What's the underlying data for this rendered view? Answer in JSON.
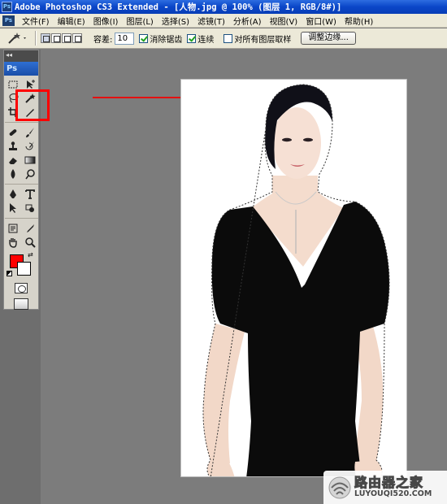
{
  "window": {
    "title": "Adobe Photoshop CS3 Extended - [人物.jpg @ 100% (图层 1, RGB/8#)]"
  },
  "menu": {
    "items": [
      "文件(F)",
      "编辑(E)",
      "图像(I)",
      "图层(L)",
      "选择(S)",
      "滤镜(T)",
      "分析(A)",
      "视图(V)",
      "窗口(W)",
      "帮助(H)"
    ]
  },
  "options": {
    "tool_icon": "magic-wand-icon",
    "tolerance_label": "容差:",
    "tolerance_value": "10",
    "antialias_label": "消除锯齿",
    "antialias_checked": true,
    "contiguous_label": "连续",
    "contiguous_checked": true,
    "sample_all_label": "对所有图层取样",
    "sample_all_checked": false,
    "refine_edge_label": "调整边缘..."
  },
  "tools": {
    "panel_header": "◂◂",
    "logo": "Ps",
    "selected_tool": "magic-wand-tool",
    "foreground_color": "#ff0000",
    "background_color": "#ffffff"
  },
  "annotation": {
    "highlight_color": "#ff0000",
    "arrow_color": "#ff0000"
  },
  "canvas": {
    "document_name": "人物.jpg",
    "zoom": "100%"
  },
  "watermark": {
    "title": "路由器之家",
    "url": "LUYOUQI520.COM"
  }
}
